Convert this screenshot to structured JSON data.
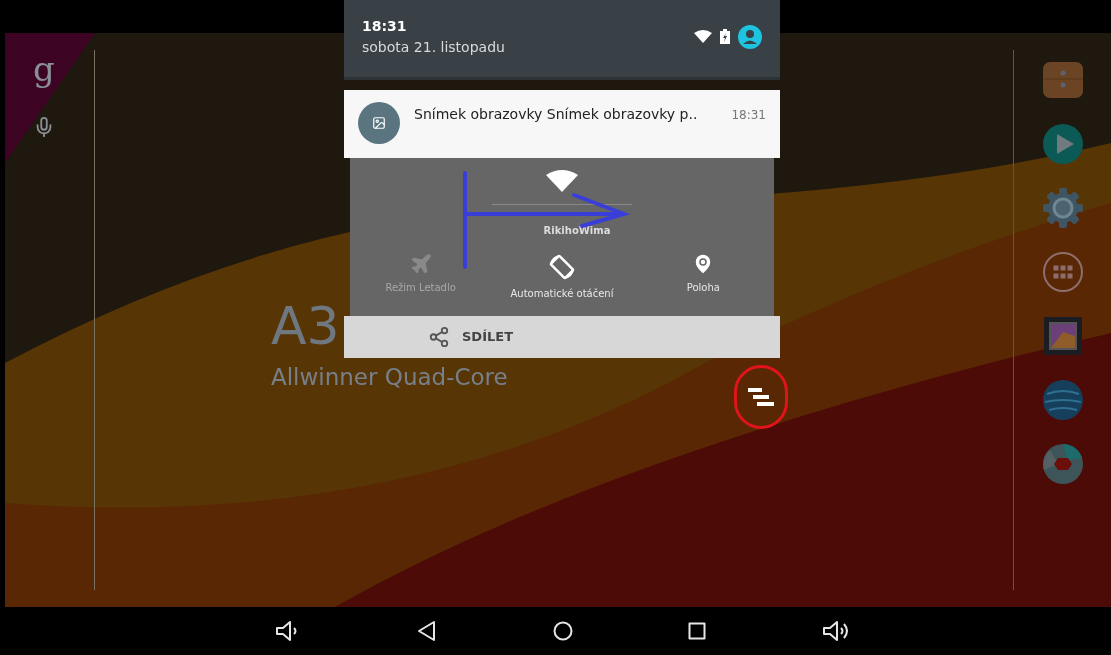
{
  "status_bar": {
    "time": "18:31",
    "date": "sobota 21. listopadu"
  },
  "notification": {
    "title": "Snímek obrazovky Snímek obrazovky p..",
    "time": "18:31",
    "preview": {
      "network": "RikihoWima",
      "tiles": [
        {
          "label": "Režim Letadlo",
          "kind": "airplane",
          "on": false
        },
        {
          "label": "Automatické otáčení",
          "kind": "rotate",
          "on": true
        },
        {
          "label": "Poloha",
          "kind": "location",
          "on": true
        }
      ]
    },
    "action": "SDÍLET"
  },
  "search": {
    "logo": "g"
  },
  "wallpaper": {
    "model": "A3",
    "chip": "Allwinner Quad-Core"
  },
  "dock": [
    {
      "kind": "files"
    },
    {
      "kind": "play"
    },
    {
      "kind": "settings"
    },
    {
      "kind": "apps"
    },
    {
      "kind": "gallery"
    },
    {
      "kind": "browser"
    },
    {
      "kind": "camera"
    }
  ],
  "nav_bar": [
    {
      "kind": "volume-down"
    },
    {
      "kind": "back"
    },
    {
      "kind": "home"
    },
    {
      "kind": "recents"
    },
    {
      "kind": "volume-up"
    }
  ]
}
